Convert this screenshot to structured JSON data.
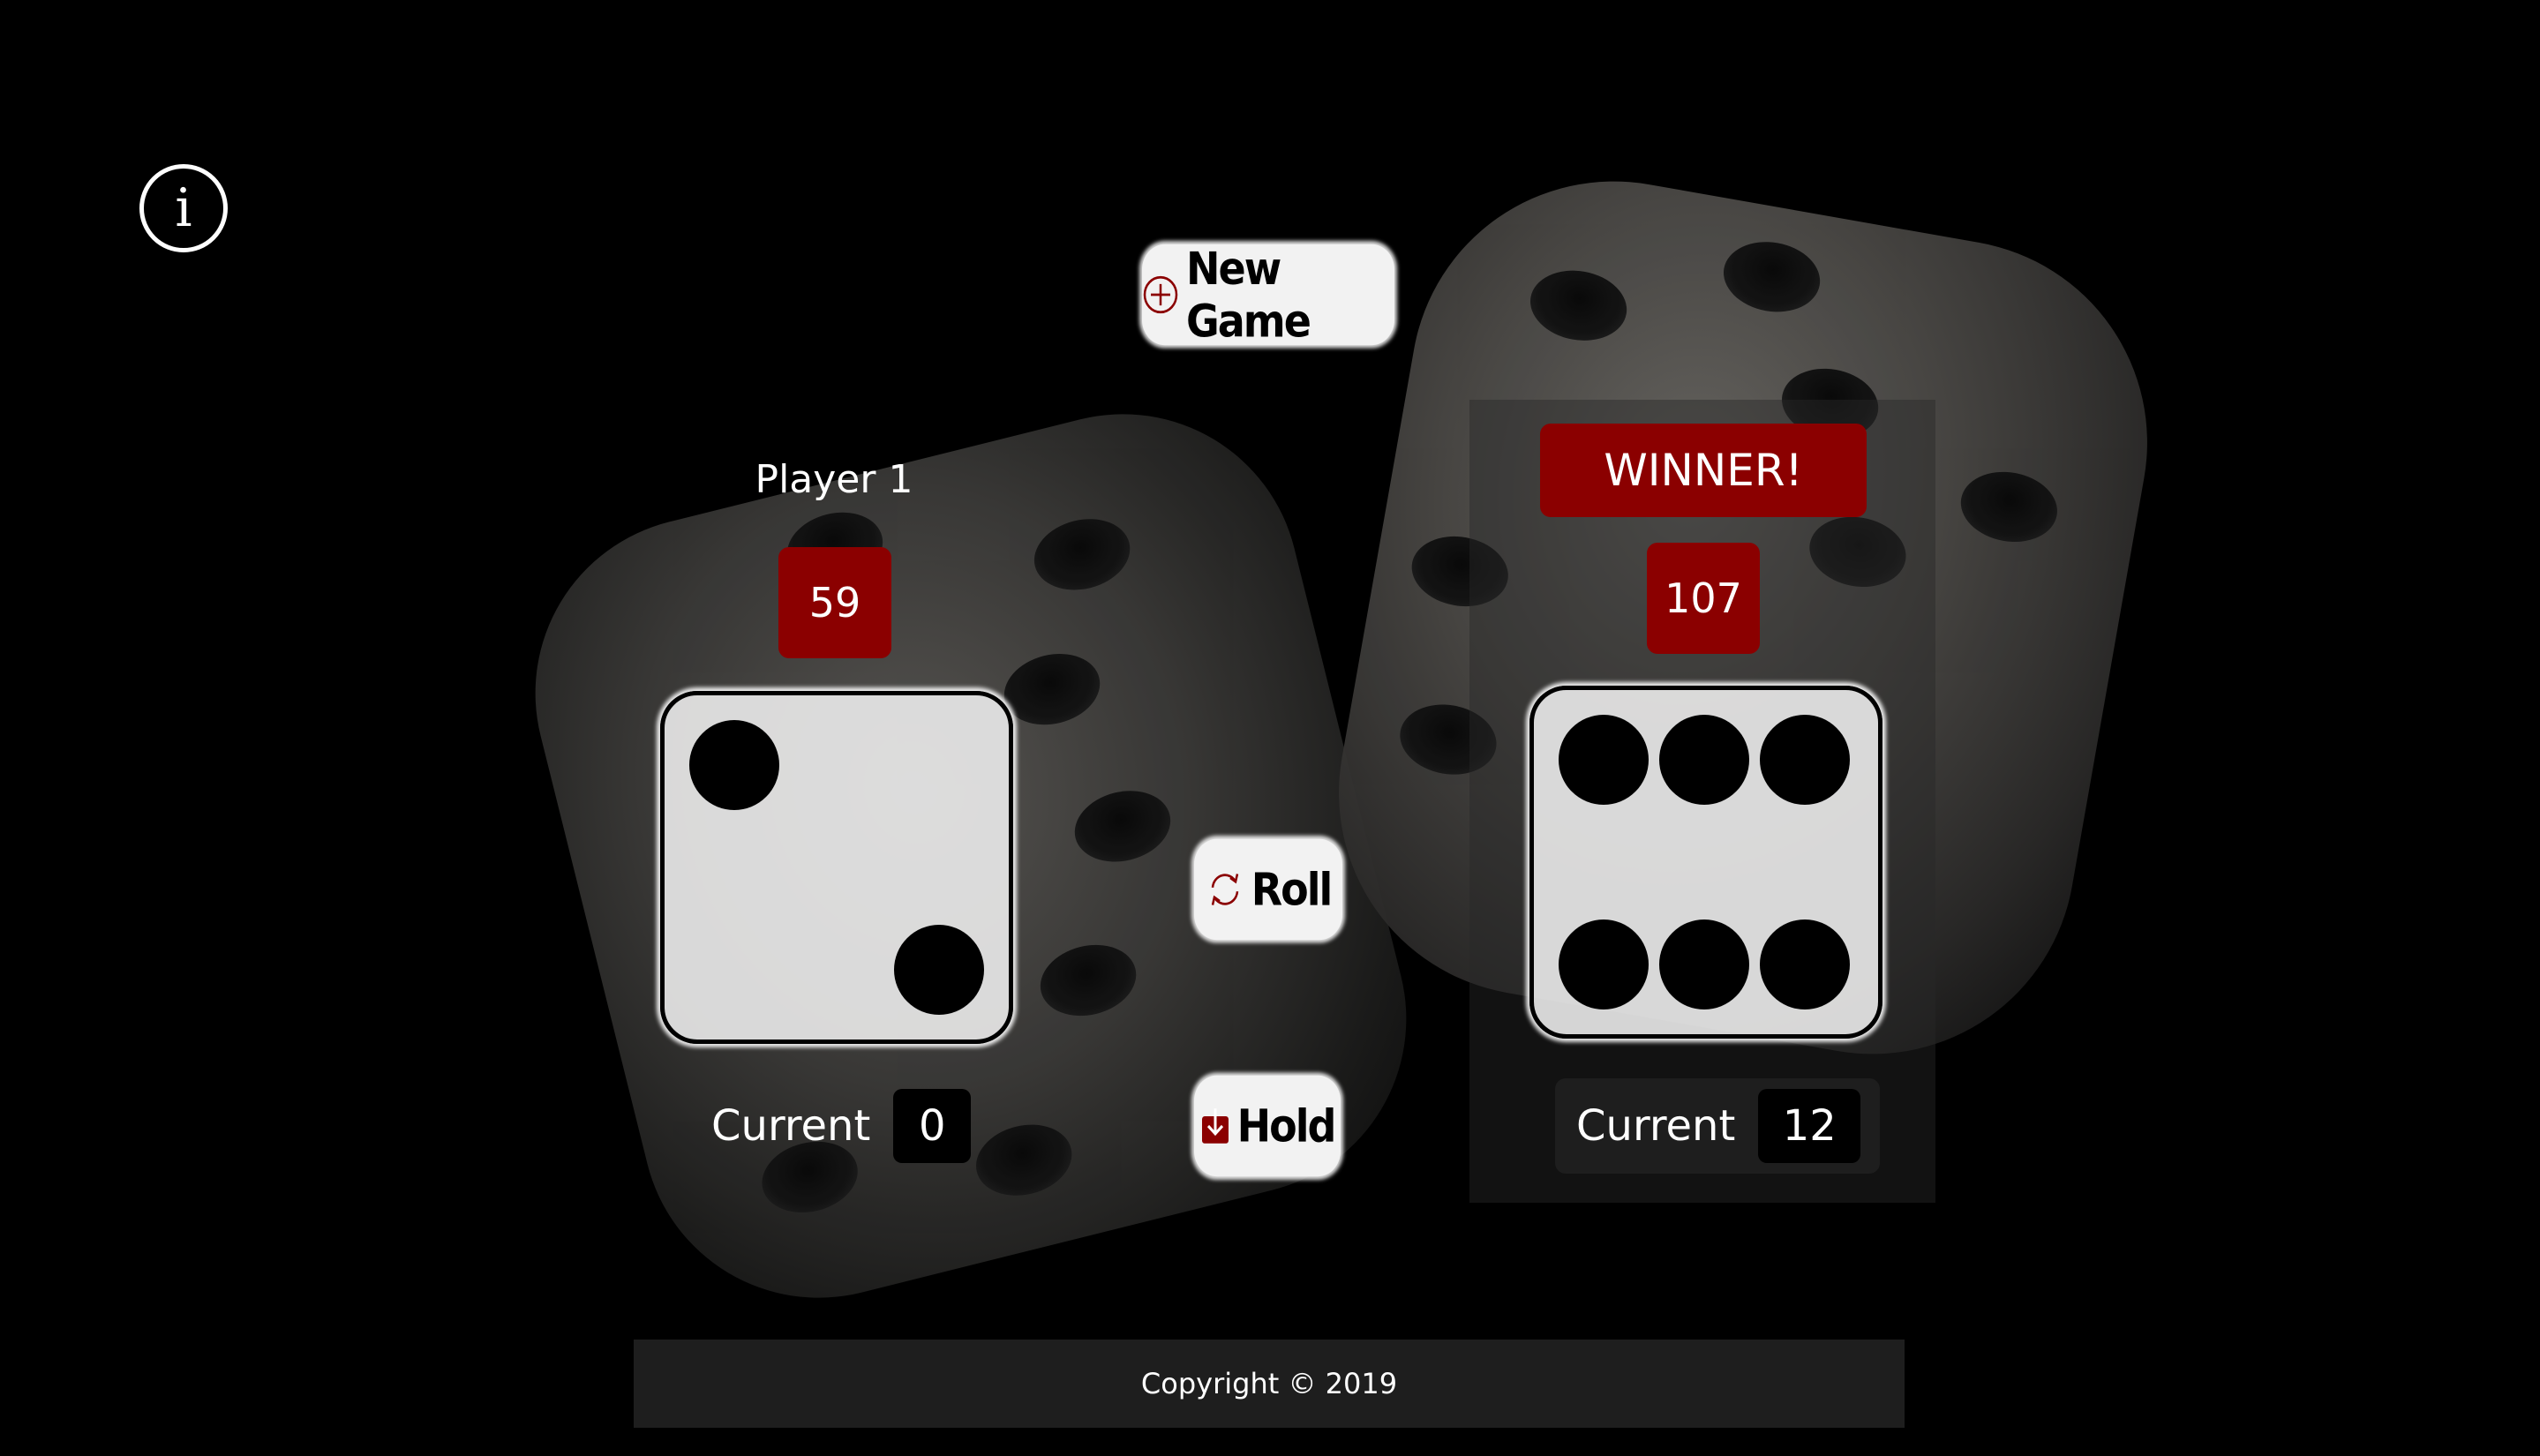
{
  "info": {
    "icon": "info-icon",
    "glyph": "i"
  },
  "buttons": {
    "new_game": {
      "label": "New Game",
      "icon": "plus-circle-icon"
    },
    "roll": {
      "label": "Roll",
      "icon": "refresh-icon"
    },
    "hold": {
      "label": "Hold",
      "icon": "download-icon"
    }
  },
  "player1": {
    "name": "Player 1",
    "score": "59",
    "die_value": 2,
    "current_label": "Current",
    "current_value": "0"
  },
  "player2": {
    "status": "WINNER!",
    "score": "107",
    "die_value": 6,
    "current_label": "Current",
    "current_value": "12"
  },
  "footer": {
    "copyright": "Copyright © 2019"
  },
  "colors": {
    "accent": "#8b0000",
    "background": "#000000",
    "button_bg": "#f2f2f2",
    "footer_bg": "#1e1e1e"
  }
}
